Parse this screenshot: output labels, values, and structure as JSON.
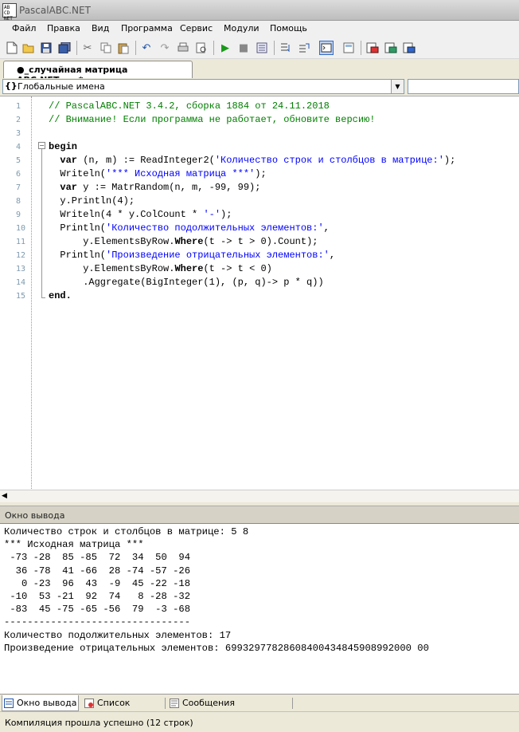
{
  "window": {
    "title": "PascalABC.NET",
    "app_icon_text": "AB CD NET"
  },
  "menu": [
    "Файл",
    "Правка",
    "Вид",
    "Программа",
    "Сервис",
    "Модули",
    "Помощь"
  ],
  "toolbar_icons": [
    "new-file-icon",
    "open-folder-icon",
    "save-icon",
    "save-all-icon",
    "cut-icon",
    "copy-icon",
    "paste-icon",
    "undo-icon",
    "redo-icon",
    "print-icon",
    "print-preview-icon",
    "run-icon",
    "stop-icon",
    "compile-icon",
    "step-into-icon",
    "step-over-icon",
    "output-window-icon",
    "form-icon",
    "debug-watch-icon",
    "debug-locals-icon",
    "debug-registers-icon"
  ],
  "editor_tab": {
    "label": "●_случайная матрица ABC.NET.pas*"
  },
  "scope": {
    "label": "Глобальные имена",
    "icon": "{}"
  },
  "code": {
    "line_numbers": [
      "1",
      "2",
      "3",
      "4",
      "5",
      "6",
      "7",
      "8",
      "9",
      "10",
      "11",
      "12",
      "13",
      "14",
      "15"
    ],
    "lines": [
      [
        {
          "t": "// PascalABC.NET 3.4.2, сборка 1884 от 24.11.2018",
          "c": "cm"
        }
      ],
      [
        {
          "t": "// Внимание! Если программа не работает, обновите версию!",
          "c": "cm"
        }
      ],
      [],
      [
        {
          "t": "begin",
          "c": "kw"
        }
      ],
      [
        {
          "t": "  var",
          "c": "kw"
        },
        {
          "t": " (n, m) := ReadInteger2(",
          "c": "nm"
        },
        {
          "t": "'Количество строк и столбцов в матрице:'",
          "c": "st"
        },
        {
          "t": ");",
          "c": "nm"
        }
      ],
      [
        {
          "t": "  Writeln(",
          "c": "nm"
        },
        {
          "t": "'*** Исходная матрица ***'",
          "c": "st"
        },
        {
          "t": ");",
          "c": "nm"
        }
      ],
      [
        {
          "t": "  var",
          "c": "kw"
        },
        {
          "t": " y := MatrRandom(n, m, -99, 99);",
          "c": "nm"
        }
      ],
      [
        {
          "t": "  y.Println(4);",
          "c": "nm"
        }
      ],
      [
        {
          "t": "  Writeln(4 * y.ColCount * ",
          "c": "nm"
        },
        {
          "t": "'-'",
          "c": "st"
        },
        {
          "t": ");",
          "c": "nm"
        }
      ],
      [
        {
          "t": "  Println(",
          "c": "nm"
        },
        {
          "t": "'Количество подолжительных элементов:'",
          "c": "st"
        },
        {
          "t": ",",
          "c": "nm"
        }
      ],
      [
        {
          "t": "      y.ElementsByRow.",
          "c": "nm"
        },
        {
          "t": "Where",
          "c": "kw"
        },
        {
          "t": "(t -> t > 0).Count);",
          "c": "nm"
        }
      ],
      [
        {
          "t": "  Println(",
          "c": "nm"
        },
        {
          "t": "'Произведение отрицательных элементов:'",
          "c": "st"
        },
        {
          "t": ",",
          "c": "nm"
        }
      ],
      [
        {
          "t": "      y.ElementsByRow.",
          "c": "nm"
        },
        {
          "t": "Where",
          "c": "kw"
        },
        {
          "t": "(t -> t < 0)",
          "c": "nm"
        }
      ],
      [
        {
          "t": "      .Aggregate(BigInteger(1), (p, q)-> p * q))",
          "c": "nm"
        }
      ],
      [
        {
          "t": "end.",
          "c": "kw"
        }
      ]
    ]
  },
  "output_panel": {
    "header": "Окно вывода",
    "lines": [
      "Количество строк и столбцов в матрице: 5 8",
      "*** Исходная матрица ***",
      " -73 -28  85 -85  72  34  50  94",
      "  36 -78  41 -66  28 -74 -57 -26",
      "   0 -23  96  43  -9  45 -22 -18",
      " -10  53 -21  92  74   8 -28 -32",
      " -83  45 -75 -65 -56  79  -3 -68",
      "--------------------------------",
      "Количество подолжительных элементов: 17",
      "Произведение отрицательных элементов: 69932977828608400434845908992000 00"
    ]
  },
  "bottom_tabs": [
    {
      "label": "Окно вывода",
      "icon": "output-window-icon",
      "active": true
    },
    {
      "label": "Список ошибок",
      "icon": "error-list-icon",
      "active": false
    },
    {
      "label": "Сообщения компилятора",
      "icon": "compiler-messages-icon",
      "active": false
    }
  ],
  "status": {
    "text": "Компиляция прошла успешно (12 строк)"
  }
}
